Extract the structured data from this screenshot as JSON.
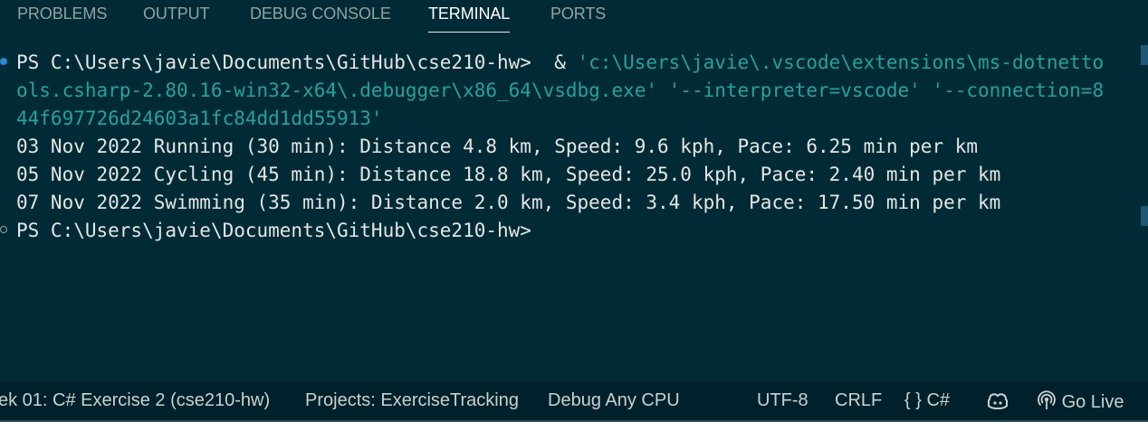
{
  "panel_tabs": [
    {
      "label": "PROBLEMS",
      "active": false
    },
    {
      "label": "OUTPUT",
      "active": false
    },
    {
      "label": "DEBUG CONSOLE",
      "active": false
    },
    {
      "label": "TERMINAL",
      "active": true
    },
    {
      "label": "PORTS",
      "active": false
    }
  ],
  "terminal": {
    "prompt_path": "PS C:\\Users\\javie\\Documents\\GitHub\\cse210-hw>",
    "command_amp": "  & ",
    "command_line1": "'c:\\Users\\javie\\.vscode\\extensions\\ms-dotnetto",
    "command_line2": "ols.csharp-2.80.16-win32-x64\\.debugger\\x86_64\\vsdbg.exe' '--interpreter=vscode' '--connection=8",
    "command_line3": "44f697726d24603a1fc84dd1dd55913'",
    "output_lines": [
      "03 Nov 2022 Running (30 min): Distance 4.8 km, Speed: 9.6 kph, Pace: 6.25 min per km",
      "05 Nov 2022 Cycling (45 min): Distance 18.8 km, Speed: 25.0 kph, Pace: 2.40 min per km",
      "07 Nov 2022 Swimming (35 min): Distance 2.0 km, Speed: 3.4 kph, Pace: 17.50 min per km"
    ],
    "final_prompt": "PS C:\\Users\\javie\\Documents\\GitHub\\cse210-hw>"
  },
  "status_bar": {
    "workspace": "ek 01: C# Exercise 2 (cse210-hw)",
    "projects": "Projects: ExerciseTracking",
    "debug_config": "Debug Any CPU",
    "encoding": "UTF-8",
    "line_ending": "CRLF",
    "braces": "{ }",
    "language": "C#",
    "copilot_icon": "copilot-icon",
    "go_live_icon": "broadcast-icon",
    "go_live": "Go Live"
  },
  "colors": {
    "background": "#002b36",
    "status_background": "#00212b",
    "string": "#2aa198",
    "accent_dot": "#268bd2"
  }
}
